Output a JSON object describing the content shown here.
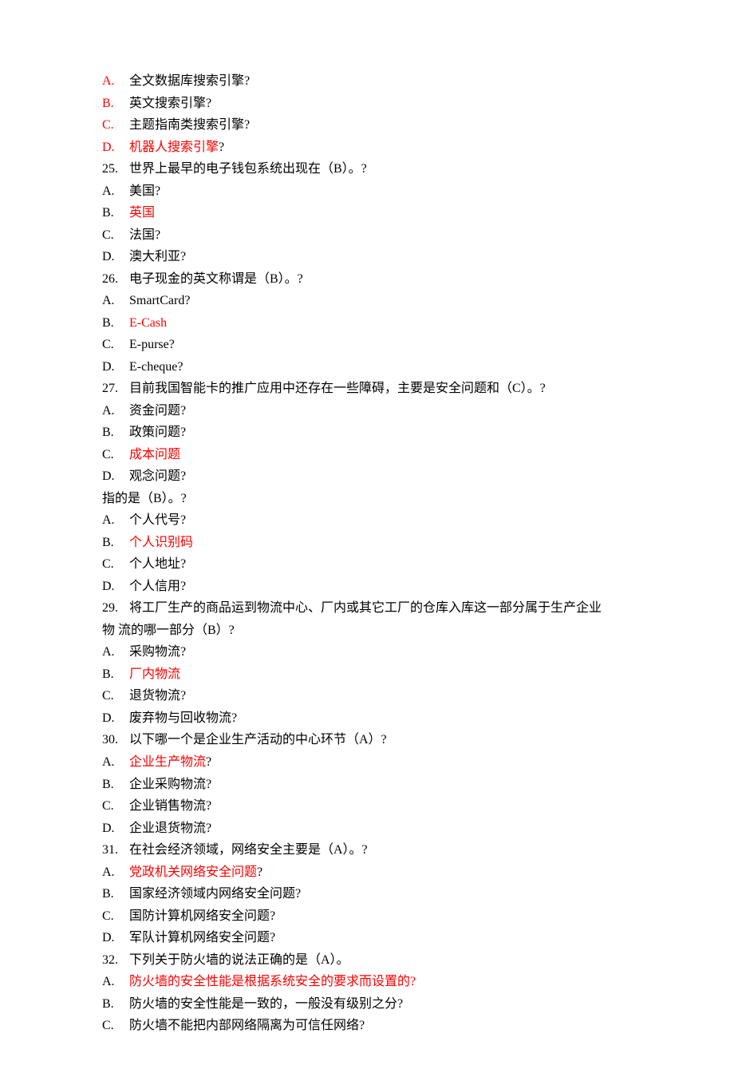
{
  "lines": [
    {
      "label": {
        "text": "A.",
        "color": "red"
      },
      "rest": [
        {
          "text": "全文数据库搜索引擎?",
          "color": "black"
        }
      ]
    },
    {
      "label": {
        "text": "B.",
        "color": "red"
      },
      "rest": [
        {
          "text": "英文搜索引擎?",
          "color": "black"
        }
      ]
    },
    {
      "label": {
        "text": "C.",
        "color": "red"
      },
      "rest": [
        {
          "text": "主题指南类搜索引擎?",
          "color": "black"
        }
      ]
    },
    {
      "label": {
        "text": "D.",
        "color": "red"
      },
      "rest": [
        {
          "text": "机器人搜索引擎",
          "color": "red"
        },
        {
          "text": "?",
          "color": "black"
        }
      ]
    },
    {
      "label": {
        "text": "25.",
        "color": "black"
      },
      "rest": [
        {
          "text": "世界上最早的电子钱包系统出现在（B）。?",
          "color": "black"
        }
      ]
    },
    {
      "label": {
        "text": "A.",
        "color": "black"
      },
      "rest": [
        {
          "text": "美国?",
          "color": "black"
        }
      ]
    },
    {
      "label": {
        "text": "B.",
        "color": "black"
      },
      "rest": [
        {
          "text": "英国",
          "color": "red"
        }
      ]
    },
    {
      "label": {
        "text": "C.",
        "color": "black"
      },
      "rest": [
        {
          "text": "法国?",
          "color": "black"
        }
      ]
    },
    {
      "label": {
        "text": "D.",
        "color": "black"
      },
      "rest": [
        {
          "text": "澳大利亚?",
          "color": "black"
        }
      ]
    },
    {
      "label": {
        "text": "26.",
        "color": "black"
      },
      "rest": [
        {
          "text": "电子现金的英文称谓是（B）。?",
          "color": "black"
        }
      ]
    },
    {
      "label": {
        "text": "A.",
        "color": "black"
      },
      "rest": [
        {
          "text": "SmartCard?",
          "color": "black"
        }
      ]
    },
    {
      "label": {
        "text": "B.",
        "color": "black"
      },
      "rest": [
        {
          "text": "E-Cash",
          "color": "red"
        }
      ]
    },
    {
      "label": {
        "text": "C.",
        "color": "black"
      },
      "rest": [
        {
          "text": "E-purse?",
          "color": "black"
        }
      ]
    },
    {
      "label": {
        "text": "D.",
        "color": "black"
      },
      "rest": [
        {
          "text": "E-cheque?",
          "color": "black"
        }
      ]
    },
    {
      "label": {
        "text": "27.",
        "color": "black"
      },
      "rest": [
        {
          "text": "目前我国智能卡的推广应用中还存在一些障碍，主要是安全问题和（C）。?",
          "color": "black"
        }
      ]
    },
    {
      "label": {
        "text": "A.",
        "color": "black"
      },
      "rest": [
        {
          "text": "资金问题?",
          "color": "black"
        }
      ]
    },
    {
      "label": {
        "text": "B.",
        "color": "black"
      },
      "rest": [
        {
          "text": "政策问题?",
          "color": "black"
        }
      ]
    },
    {
      "label": {
        "text": "C.",
        "color": "black"
      },
      "rest": [
        {
          "text": "成本问题",
          "color": "red"
        }
      ]
    },
    {
      "label": {
        "text": "D.",
        "color": "black"
      },
      "rest": [
        {
          "text": "观念问题?",
          "color": "black"
        }
      ]
    },
    {
      "plain": "指的是（B）。?",
      "color": "black"
    },
    {
      "label": {
        "text": "A.",
        "color": "black"
      },
      "rest": [
        {
          "text": "个人代号?",
          "color": "black"
        }
      ]
    },
    {
      "label": {
        "text": "B.",
        "color": "black"
      },
      "rest": [
        {
          "text": "个人识别码",
          "color": "red"
        }
      ]
    },
    {
      "label": {
        "text": "C.",
        "color": "black"
      },
      "rest": [
        {
          "text": "个人地址?",
          "color": "black"
        }
      ]
    },
    {
      "label": {
        "text": "D.",
        "color": "black"
      },
      "rest": [
        {
          "text": "个人信用?",
          "color": "black"
        }
      ]
    },
    {
      "label": {
        "text": "29.",
        "color": "black"
      },
      "rest": [
        {
          "text": "将工厂生产的商品运到物流中心、厂内或其它工厂的仓库入库这一部分属于生产企业",
          "color": "black"
        }
      ]
    },
    {
      "plain": "物 流的哪一部分（B）?",
      "color": "black"
    },
    {
      "label": {
        "text": "A.",
        "color": "black"
      },
      "rest": [
        {
          "text": "采购物流?",
          "color": "black"
        }
      ]
    },
    {
      "label": {
        "text": "B.",
        "color": "black"
      },
      "rest": [
        {
          "text": "厂内物流",
          "color": "red"
        }
      ]
    },
    {
      "label": {
        "text": "C.",
        "color": "black"
      },
      "rest": [
        {
          "text": "退货物流?",
          "color": "black"
        }
      ]
    },
    {
      "label": {
        "text": "D.",
        "color": "black"
      },
      "rest": [
        {
          "text": "废弃物与回收物流?",
          "color": "black"
        }
      ]
    },
    {
      "label": {
        "text": "30.",
        "color": "black"
      },
      "rest": [
        {
          "text": "以下哪一个是企业生产活动的中心环节（A）?",
          "color": "black"
        }
      ]
    },
    {
      "label": {
        "text": "A.",
        "color": "black"
      },
      "rest": [
        {
          "text": "企业生产物流",
          "color": "red"
        },
        {
          "text": "?",
          "color": "black"
        }
      ]
    },
    {
      "label": {
        "text": "B.",
        "color": "black"
      },
      "rest": [
        {
          "text": "企业采购物流?",
          "color": "black"
        }
      ]
    },
    {
      "label": {
        "text": "C.",
        "color": "black"
      },
      "rest": [
        {
          "text": "企业销售物流?",
          "color": "black"
        }
      ]
    },
    {
      "label": {
        "text": "D.",
        "color": "black"
      },
      "rest": [
        {
          "text": "企业退货物流?",
          "color": "black"
        }
      ]
    },
    {
      "label": {
        "text": "31.",
        "color": "black"
      },
      "rest": [
        {
          "text": "在社会经济领域，网络安全主要是（A）。?",
          "color": "black"
        }
      ]
    },
    {
      "label": {
        "text": "A.",
        "color": "black"
      },
      "rest": [
        {
          "text": "党政机关网络安全问题",
          "color": "red"
        },
        {
          "text": "?",
          "color": "black"
        }
      ]
    },
    {
      "label": {
        "text": "B.",
        "color": "black"
      },
      "rest": [
        {
          "text": "国家经济领域内网络安全问题?",
          "color": "black"
        }
      ]
    },
    {
      "label": {
        "text": "C.",
        "color": "black"
      },
      "rest": [
        {
          "text": "国防计算机网络安全问题?",
          "color": "black"
        }
      ]
    },
    {
      "label": {
        "text": "D.",
        "color": "black"
      },
      "rest": [
        {
          "text": "军队计算机网络安全问题?",
          "color": "black"
        }
      ]
    },
    {
      "label": {
        "text": "32.",
        "color": "black"
      },
      "rest": [
        {
          "text": "下列关于防火墙的说法正确的是（A）。",
          "color": "black"
        }
      ]
    },
    {
      "label": {
        "text": "A.",
        "color": "black"
      },
      "rest": [
        {
          "text": "防火墙的安全性能是根据系统安全的要求而设置的?",
          "color": "red"
        }
      ]
    },
    {
      "label": {
        "text": "B.",
        "color": "black"
      },
      "rest": [
        {
          "text": "防火墙的安全性能是一致的，一般没有级别之分?",
          "color": "black"
        }
      ]
    },
    {
      "label": {
        "text": "C.",
        "color": "black"
      },
      "rest": [
        {
          "text": "防火墙不能把内部网络隔离为可信任网络?",
          "color": "black"
        }
      ]
    }
  ]
}
